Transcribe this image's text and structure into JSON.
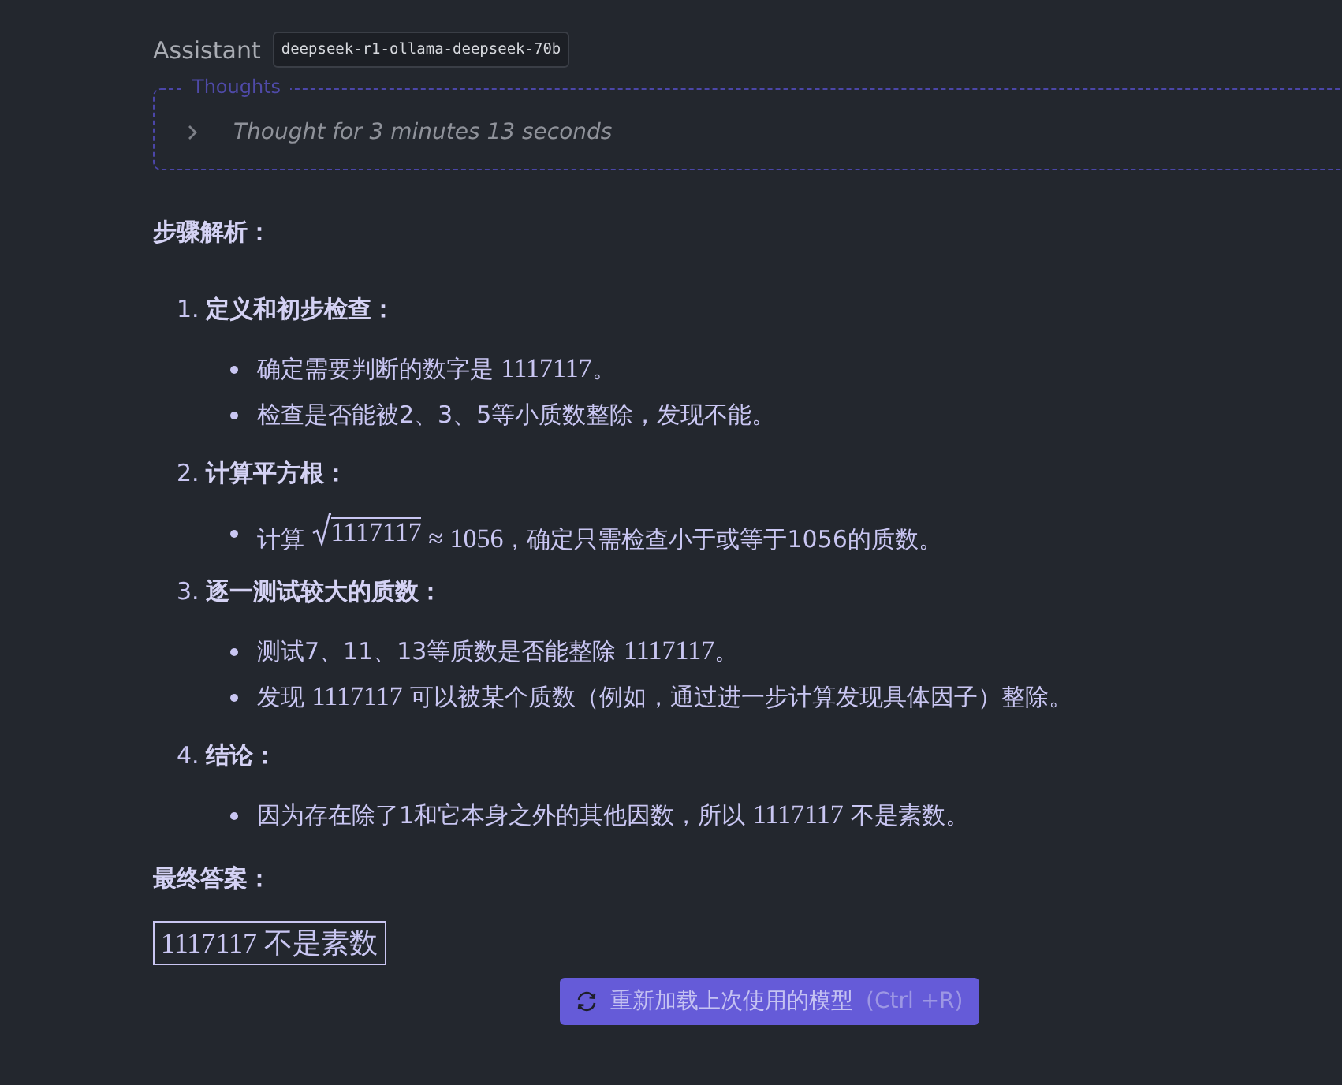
{
  "header": {
    "role": "Assistant",
    "model": "deepseek-r1-ollama-deepseek-70b"
  },
  "thoughts": {
    "legend": "Thoughts",
    "expanded": false,
    "summary": "Thought for 3 minutes 13 seconds"
  },
  "heading": "步骤解析：",
  "steps": [
    {
      "number": "1.",
      "title": "定义和初步检查：",
      "bullets": [
        [
          {
            "kind": "text",
            "text": "确定需要判断的数字是 "
          },
          {
            "kind": "math",
            "text": "1117117"
          },
          {
            "kind": "text",
            "text": "。"
          }
        ],
        [
          {
            "kind": "text",
            "text": "检查是否能被2、3、5等小质数整除，发现不能。"
          }
        ]
      ]
    },
    {
      "number": "2.",
      "title": "计算平方根：",
      "bullets": [
        [
          {
            "kind": "text",
            "text": "计算 "
          },
          {
            "kind": "sqrt",
            "text": "1117117"
          },
          {
            "kind": "math",
            "text": " ≈ 1056"
          },
          {
            "kind": "text",
            "text": "，确定只需检查小于或等于1056的质数。"
          }
        ]
      ]
    },
    {
      "number": "3.",
      "title": "逐一测试较大的质数：",
      "bullets": [
        [
          {
            "kind": "text",
            "text": "测试7、11、13等质数是否能整除 "
          },
          {
            "kind": "math",
            "text": "1117117"
          },
          {
            "kind": "text",
            "text": "。"
          }
        ],
        [
          {
            "kind": "text",
            "text": "发现 "
          },
          {
            "kind": "math",
            "text": "1117117"
          },
          {
            "kind": "text",
            "text": " 可以被某个质数（例如，通过进一步计算发现具体因子）整除。"
          }
        ]
      ]
    },
    {
      "number": "4.",
      "title": "结论：",
      "bullets": [
        [
          {
            "kind": "text",
            "text": "因为存在除了1和它本身之外的其他因数，所以 "
          },
          {
            "kind": "math",
            "text": "1117117"
          },
          {
            "kind": "text",
            "text": " 不是素数。"
          }
        ]
      ]
    }
  ],
  "final_heading": "最终答案：",
  "final_answer": "1117117 不是素数",
  "reload_button": {
    "label": "重新加载上次使用的模型",
    "shortcut": "(Ctrl +R)"
  }
}
